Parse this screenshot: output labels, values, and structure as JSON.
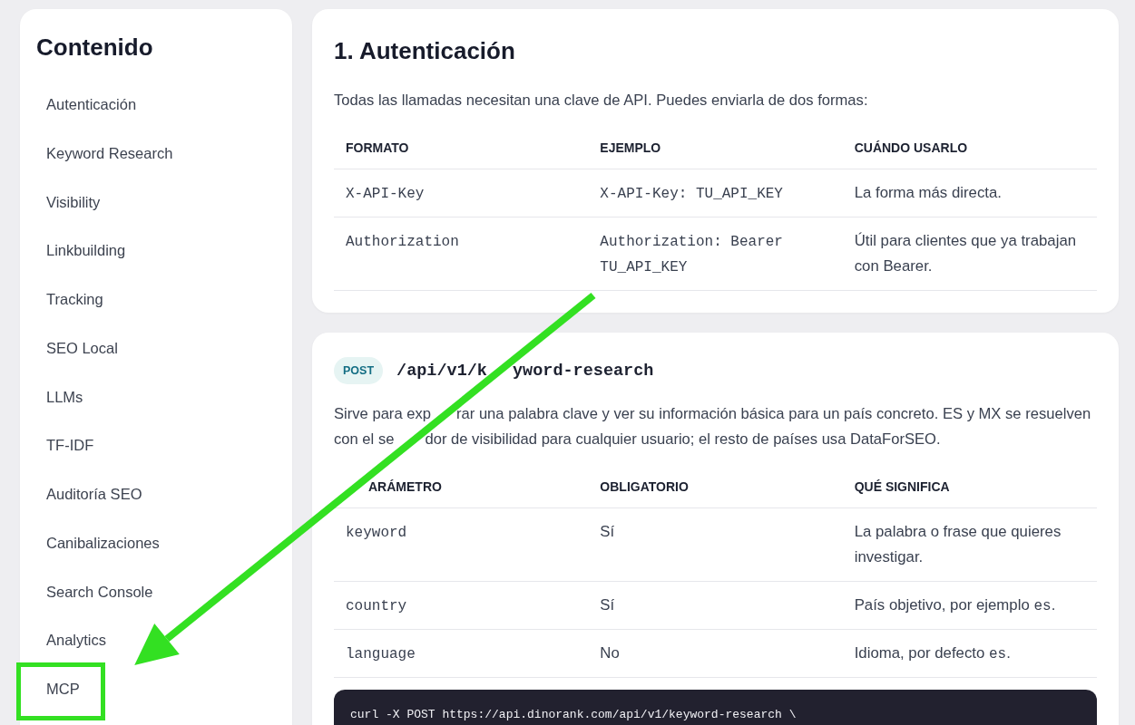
{
  "sidebar": {
    "title": "Contenido",
    "items": [
      {
        "label": "Autenticación",
        "selected": false,
        "highlighted": false
      },
      {
        "label": "Keyword Research",
        "selected": false,
        "highlighted": false
      },
      {
        "label": "Visibility",
        "selected": false,
        "highlighted": false
      },
      {
        "label": "Linkbuilding",
        "selected": false,
        "highlighted": false
      },
      {
        "label": "Tracking",
        "selected": false,
        "highlighted": false
      },
      {
        "label": "SEO Local",
        "selected": false,
        "highlighted": false
      },
      {
        "label": "LLMs",
        "selected": false,
        "highlighted": false
      },
      {
        "label": "TF-IDF",
        "selected": false,
        "highlighted": false
      },
      {
        "label": "Auditoría SEO",
        "selected": false,
        "highlighted": false
      },
      {
        "label": "Canibalizaciones",
        "selected": false,
        "highlighted": false
      },
      {
        "label": "Search Console",
        "selected": false,
        "highlighted": false
      },
      {
        "label": "Analytics",
        "selected": false,
        "highlighted": false
      },
      {
        "label": "MCP",
        "selected": false,
        "highlighted": true
      }
    ]
  },
  "sections": [
    {
      "kind": "section",
      "heading": "1. Autenticación",
      "intro_lines": [
        [
          "Todas las llamadas necesitan una clave de API. Puedes enviarla de dos formas:"
        ]
      ],
      "table": {
        "columns": [
          {
            "label": "FORMATO",
            "covered_start": false
          },
          {
            "label": "EJEMPLO",
            "covered_start": false
          },
          {
            "label": "CUÁNDO USARLO",
            "covered_start": false
          }
        ],
        "rows": [
          [
            [
              {
                "kind": "code",
                "text": "X-API-Key"
              }
            ],
            [
              {
                "kind": "code",
                "text": "X-API-Key: TU_API_KEY"
              }
            ],
            [
              {
                "kind": "text",
                "text": "La forma más directa."
              }
            ]
          ],
          [
            [
              {
                "kind": "code",
                "text": "Authorization"
              }
            ],
            [
              {
                "kind": "code",
                "text": "Authorization: Bearer TU_API_KEY"
              }
            ],
            [
              {
                "kind": "text",
                "text": "Útil para clientes que ya trabajan con Bearer."
              }
            ]
          ]
        ]
      }
    },
    {
      "kind": "endpoint",
      "method": "POST",
      "path": [
        "/api/v1/k",
        "yword-research"
      ],
      "intro_lines": [
        [
          "Sirve para exp",
          "rar una palabra clave y ver su información básica para un país concreto. ES y MX se resuelven"
        ],
        [
          "con el se",
          "dor de visibilidad para cualquier usuario; el resto de países usa DataForSEO."
        ]
      ],
      "table": {
        "columns": [
          {
            "label": "ARÁMETRO",
            "covered_start": true
          },
          {
            "label": "OBLIGATORIO",
            "covered_start": false
          },
          {
            "label": "QUÉ SIGNIFICA",
            "covered_start": false
          }
        ],
        "rows": [
          [
            [
              {
                "kind": "code",
                "text": "keyword"
              }
            ],
            [
              {
                "kind": "text",
                "text": "Sí"
              }
            ],
            [
              {
                "kind": "text",
                "text": "La palabra o frase que quieres investigar."
              }
            ]
          ],
          [
            [
              {
                "kind": "code",
                "text": "country"
              }
            ],
            [
              {
                "kind": "text",
                "text": "Sí"
              }
            ],
            [
              {
                "kind": "text",
                "text": "País objetivo, por ejemplo "
              },
              {
                "kind": "code",
                "text": "es"
              },
              {
                "kind": "text",
                "text": "."
              }
            ]
          ],
          [
            [
              {
                "kind": "code",
                "text": "language"
              }
            ],
            [
              {
                "kind": "text",
                "text": "No"
              }
            ],
            [
              {
                "kind": "text",
                "text": "Idioma, por defecto "
              },
              {
                "kind": "code",
                "text": "es"
              },
              {
                "kind": "text",
                "text": "."
              }
            ]
          ]
        ]
      },
      "code": [
        "curl -X POST https://api.dinorank.com/api/v1/keyword-research \\"
      ]
    }
  ],
  "annotation": {
    "kind": "arrow"
  }
}
